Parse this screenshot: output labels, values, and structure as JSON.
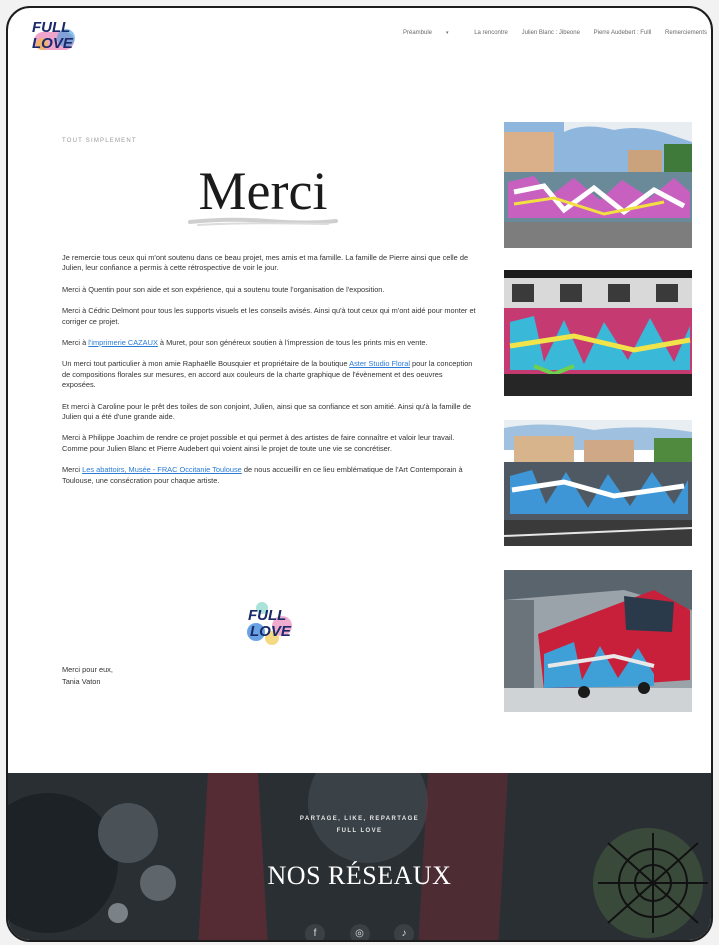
{
  "brand": {
    "logo_text_1": "FULL",
    "logo_text_2": "LOVE"
  },
  "nav": {
    "items": [
      {
        "label": "Préambule",
        "has_dropdown": true
      },
      {
        "label": "La rencontre"
      },
      {
        "label": "Julien Blanc : Jibeone"
      },
      {
        "label": "Pierre Audebert : Fulll"
      },
      {
        "label": "Remerciements"
      }
    ]
  },
  "content": {
    "kicker": "TOUT SIMPLEMENT",
    "title": "Merci",
    "p1": "Je remercie tous ceux qui m'ont soutenu dans ce beau projet, mes amis et ma famille. La famille de Pierre ainsi que celle de Julien, leur confiance a permis à cette rétrospective de voir le jour.",
    "p2": "Merci à Quentin pour son aide et son expérience, qui a soutenu toute l'organisation de l'exposition.",
    "p3": "Merci à Cédric Delmont pour tous les supports visuels et les conseils avisés. Ainsi qu'à tout ceux qui m'ont aidé pour monter et corriger ce projet.",
    "p4_pre": "Merci à ",
    "p4_link": "l'imprimerie CAZAUX",
    "p4_post": " à Muret, pour son généreux soutien à l'impression de tous les prints mis en vente.",
    "p5_pre": "Un merci tout particulier à mon amie Raphaëlle Bousquier et propriétaire de la boutique ",
    "p5_link": "Aster Studio Floral",
    "p5_post": " pour la conception de compositions florales sur mesures, en accord aux couleurs de la charte graphique de l'évènement et des oeuvres exposées.",
    "p6": "Et merci à Caroline pour le prêt des toiles de son conjoint, Julien, ainsi que sa confiance et son amitié. Ainsi qu'à la famille de Julien qui a été d'une grande aide.",
    "p7": "Merci à Philippe Joachim de rendre ce projet possible et qui permet à des artistes de faire connaître et valoir leur travail. Comme pour Julien Blanc et Pierre Audebert qui voient ainsi le projet de toute une vie se concrétiser.",
    "p8_pre": "Merci ",
    "p8_link": "Les abattoirs, Musée - FRAC Occitanie Toulouse",
    "p8_post": " de nous accueillir en ce lieu emblématique de l'Art Contemporain à Toulouse, une consécration pour chaque artiste.",
    "sign_line1": "Merci pour eux,",
    "sign_line2": "Tania Vaton"
  },
  "photos": [
    {
      "subject": "graffiti-wall-buildings"
    },
    {
      "subject": "graffiti-train"
    },
    {
      "subject": "graffiti-wall-street"
    },
    {
      "subject": "graffiti-red-train"
    }
  ],
  "footer": {
    "subtitle_1": "PARTAGE, LIKE, REPARTAGE",
    "subtitle_2": "FULL LOVE",
    "title": "NOS RÉSEAUX",
    "social_icons": [
      "facebook-icon",
      "instagram-icon",
      "tiktok-icon"
    ]
  },
  "colors": {
    "link": "#2a7bd8",
    "footer_bg": "#2a2f33"
  }
}
